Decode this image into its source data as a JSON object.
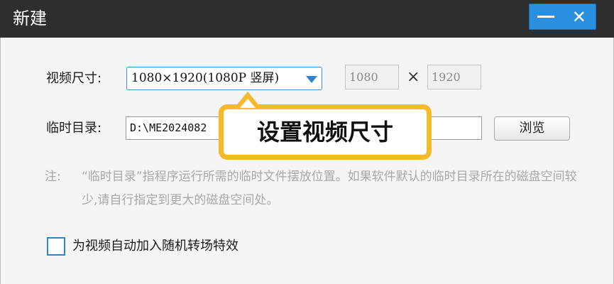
{
  "window": {
    "title": "新建",
    "minimize_icon": "minimize-icon",
    "close_icon": "close-icon",
    "close_glyph": "✕",
    "accent": "#2b8fe0"
  },
  "video_size": {
    "label": "视频尺寸:",
    "selected": "1080×1920(1080P 竖屏)",
    "width_value": "1080",
    "times": "×",
    "height_value": "1920"
  },
  "temp_dir": {
    "label": "临时目录:",
    "path_visible": "D:\\ME2024082",
    "browse_label": "浏览"
  },
  "callout": {
    "text": "设置视频尺寸",
    "border_color": "#f6b929"
  },
  "note": {
    "prefix": "注:",
    "text": "“临时目录”指程序运行所需的临时文件摆放位置。如果软件默认的临时目录所在的磁盘空间较少,请自行指定到更大的磁盘空间处。"
  },
  "options": {
    "random_transition_label": "为视频自动加入随机转场特效",
    "random_transition_checked": false
  }
}
